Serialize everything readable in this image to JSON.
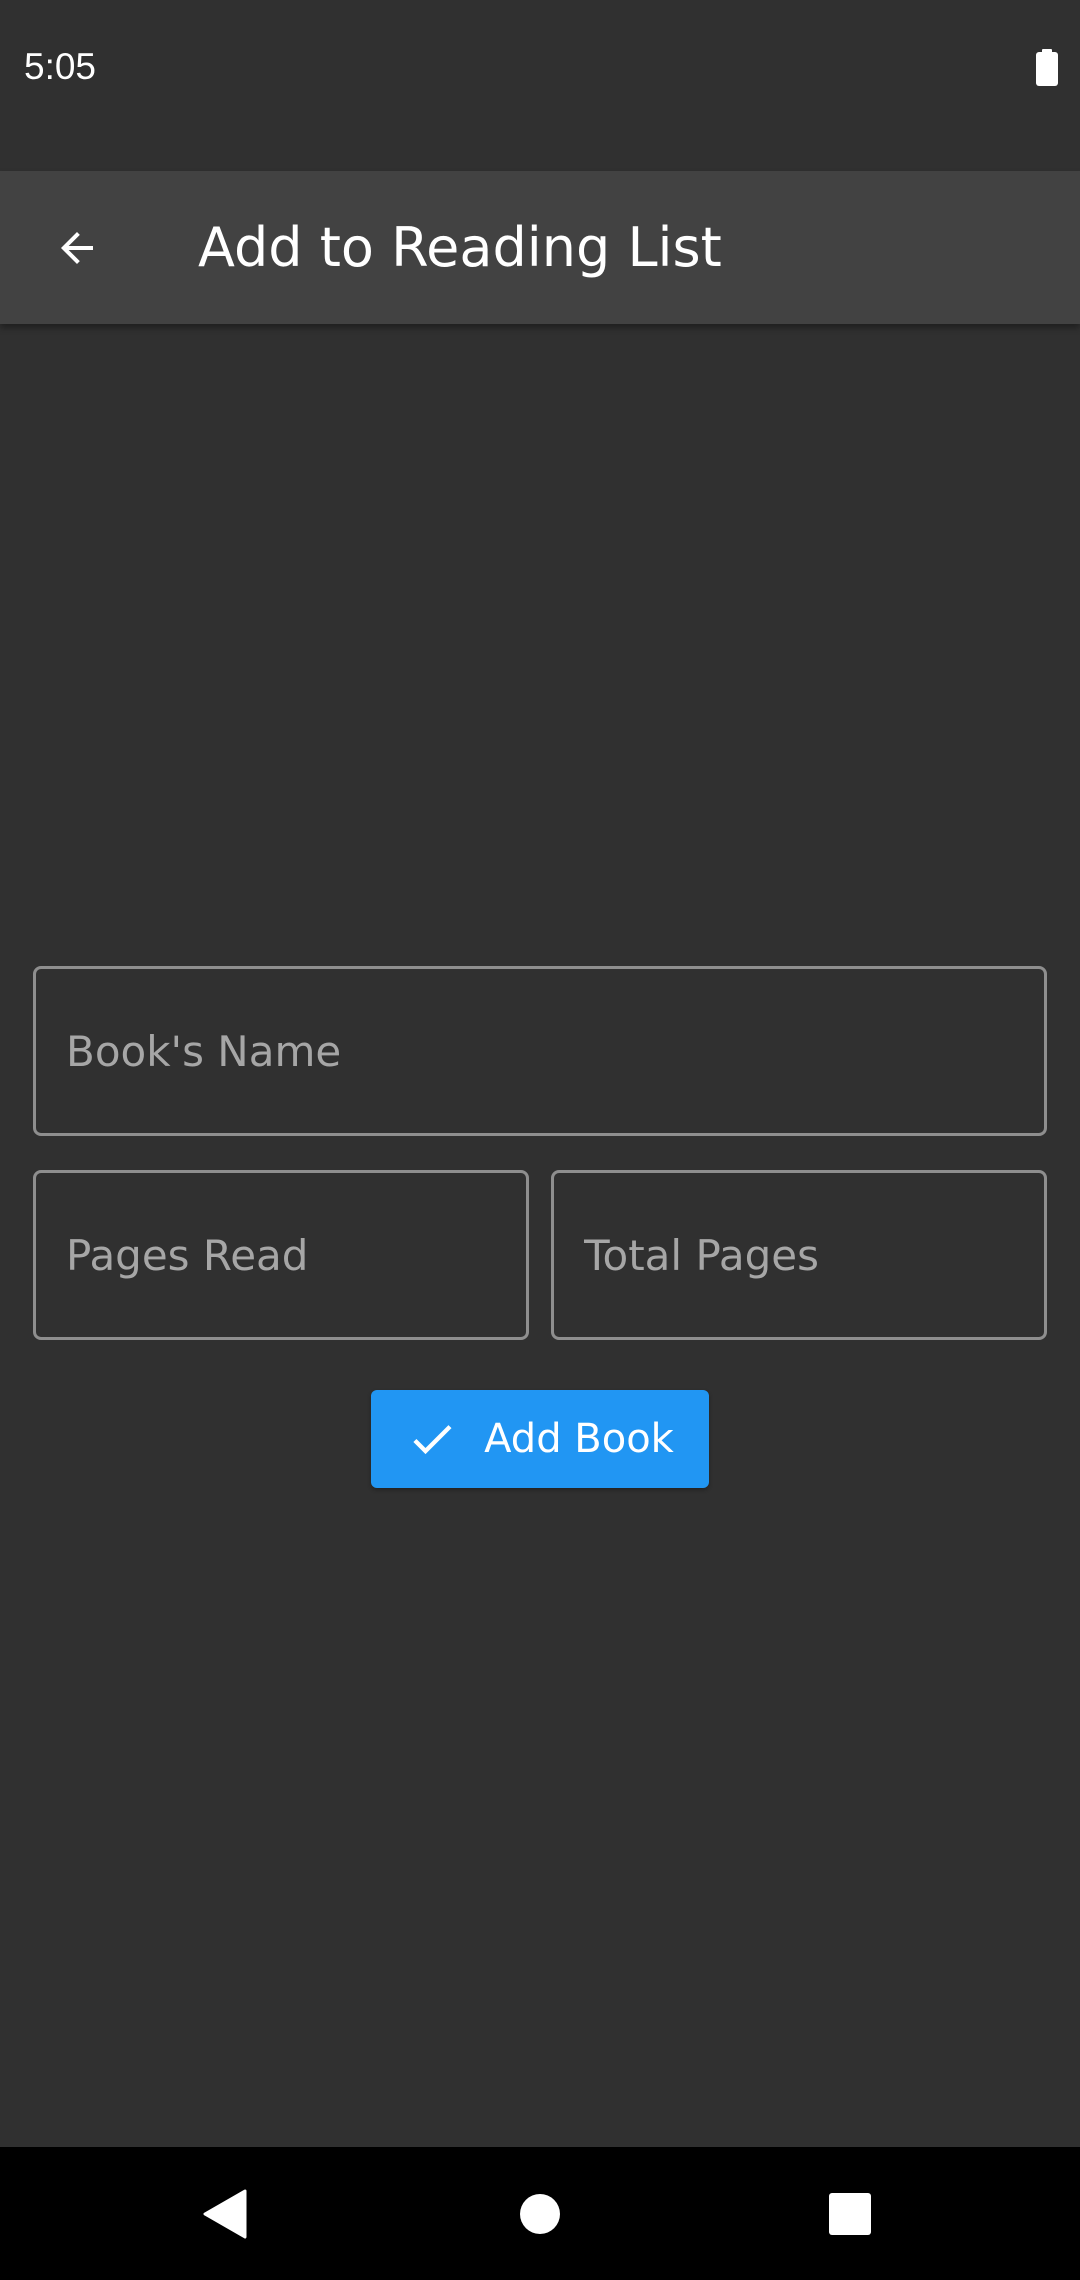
{
  "status_bar": {
    "time": "5:05",
    "battery_icon": "battery-full-icon"
  },
  "app_bar": {
    "back_icon": "arrow-back-icon",
    "title": "Add to Reading List"
  },
  "form": {
    "book_name_placeholder": "Book's Name",
    "pages_read_placeholder": "Pages Read",
    "total_pages_placeholder": "Total Pages",
    "submit_icon": "check-icon",
    "submit_label": "Add Book"
  },
  "nav_bar": {
    "back_icon": "nav-back-icon",
    "home_icon": "nav-home-icon",
    "recents_icon": "nav-recents-icon"
  },
  "colors": {
    "background": "#303030",
    "app_bar": "#424242",
    "accent": "#2196f3",
    "field_border": "#8e8e8e",
    "placeholder": "#a6a6a6"
  }
}
